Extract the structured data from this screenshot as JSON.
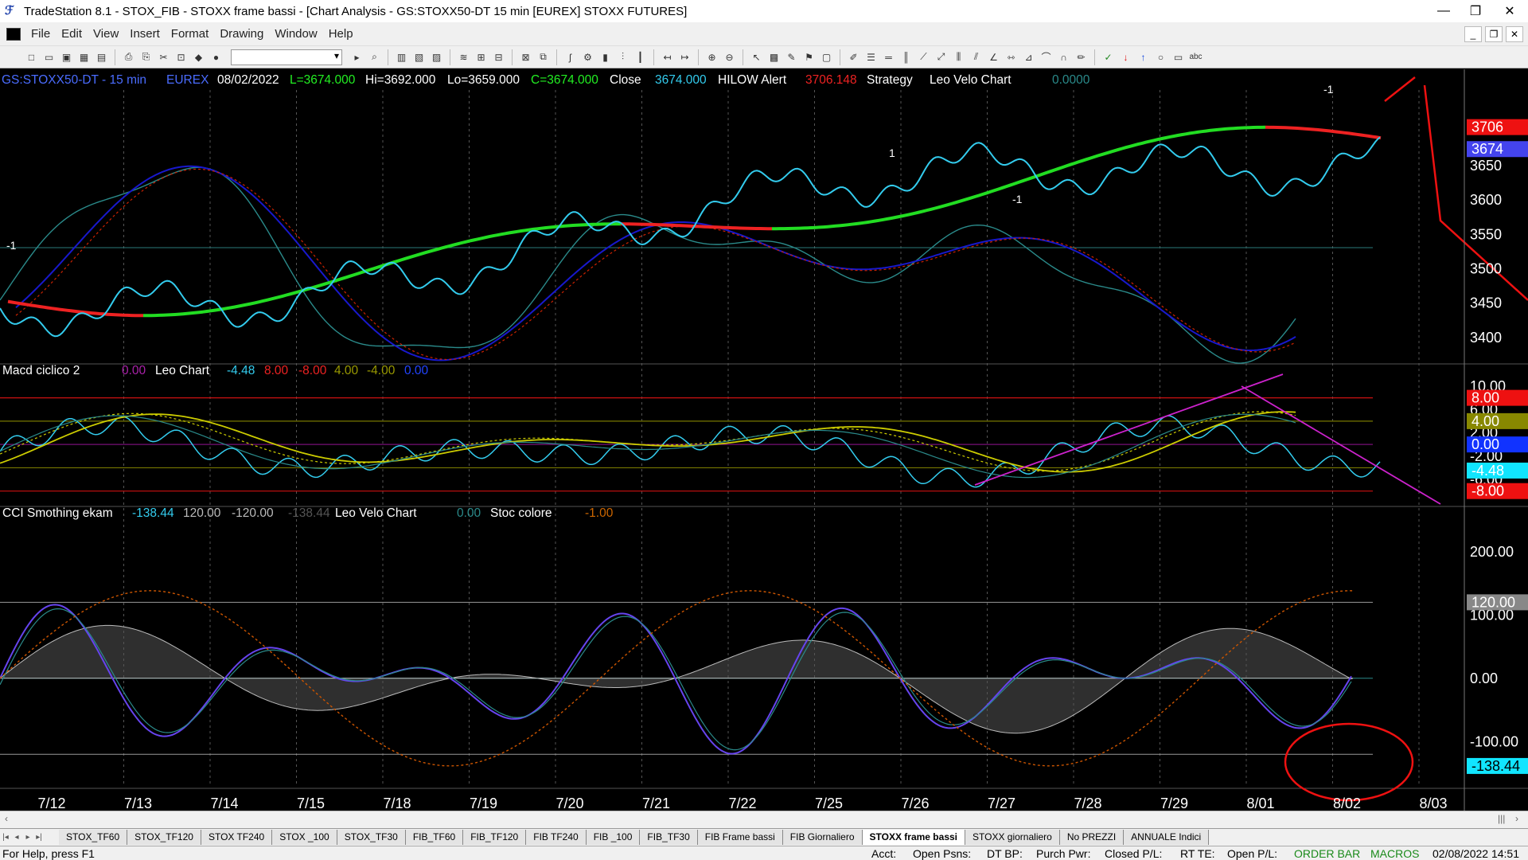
{
  "window": {
    "title": "TradeStation 8.1 - STOX_FIB - STOXX frame bassi - [Chart Analysis - GS:STOXX50-DT  15 min  [EUREX] STOXX FUTURES]",
    "minimize_icon": "minimize-icon",
    "restore_icon": "restore-icon",
    "close_icon": "close-icon"
  },
  "menu": {
    "items": [
      "File",
      "Edit",
      "View",
      "Insert",
      "Format",
      "Drawing",
      "Window",
      "Help"
    ]
  },
  "chart": {
    "price_pane": {
      "header": {
        "symbol": "GS:STOXX50-DT - 15 min",
        "exchange": "EUREX",
        "date": "08/02/2022",
        "last": "L=3674.000",
        "high": "Hi=3692.000",
        "low": "Lo=3659.000",
        "close_field": "C=3674.000",
        "close_label": "Close",
        "close_value": "3674.000",
        "hilow_label": "HILOW Alert",
        "hilow_value": "3706.148",
        "strategy_label": "Strategy",
        "leo_velo_label": "Leo Velo Chart",
        "leo_velo_value": "0.0000"
      },
      "ylim": [
        3365,
        3760
      ],
      "ticks": [
        "3650",
        "3600",
        "3550",
        "3500",
        "3450",
        "3400"
      ],
      "tick_values": [
        3650,
        3600,
        3550,
        3500,
        3450,
        3400
      ],
      "marker_red": "3706",
      "marker_red_value": 3706,
      "marker_blue": "3674",
      "marker_blue_value": 3674,
      "signal_labels": [
        "-1",
        "1",
        "-1",
        "1",
        "-1"
      ],
      "colors": {
        "price": "#33ccee",
        "ma_up": "#22dd22",
        "ma_down": "#ee2222",
        "osc_blue": "#1818cc",
        "osc_teal": "#2a8a8a",
        "osc_dotred": "#cc2200"
      }
    },
    "macd_pane": {
      "header": {
        "title": "Macd ciclico 2",
        "v1": "0.00",
        "leo_label": "Leo Chart",
        "v2": "-4.48",
        "v3": "8.00",
        "v4": "-8.00",
        "v5": "4.00",
        "v6": "-4.00",
        "v7": "0.00"
      },
      "ylim": [
        -10.5,
        11.5
      ],
      "ticks": [
        "10.00",
        "6.00",
        "2.00",
        "-2.00",
        "-6.00"
      ],
      "tick_values": [
        10,
        6,
        2,
        -2,
        -6
      ],
      "markers": [
        {
          "label": "8.00",
          "value": 8,
          "color": "#ee1111"
        },
        {
          "label": "4.00",
          "value": 4,
          "color": "#888800"
        },
        {
          "label": "0.00",
          "value": 0,
          "color": "#1133ff"
        },
        {
          "label": "-4.48",
          "value": -4.48,
          "color": "#11e5ff"
        },
        {
          "label": "-8.00",
          "value": -8,
          "color": "#ee1111"
        }
      ]
    },
    "cci_pane": {
      "header": {
        "title": "CCI Smothing ekam",
        "v1": "-138.44",
        "v2": "120.00",
        "v3": "-120.00",
        "v4": "-138.44",
        "leo_label": "Leo Velo Chart",
        "v5": "0.00",
        "stoc_label": "Stoc colore",
        "v6": "-1.00"
      },
      "ylim": [
        -170,
        250
      ],
      "ticks": [
        "200.00",
        "100.00",
        "0.00",
        "-100.00"
      ],
      "tick_values": [
        200,
        100,
        0,
        -100
      ],
      "markers": [
        {
          "label": "120.00",
          "value": 120,
          "color": "#aaaaaa"
        },
        {
          "label": "-138.44",
          "value": -138.44,
          "color": "#11e5ff"
        }
      ]
    },
    "dates": [
      "7/12",
      "7/13",
      "7/14",
      "7/15",
      "7/18",
      "7/19",
      "7/20",
      "7/21",
      "7/22",
      "7/25",
      "7/26",
      "7/27",
      "7/28",
      "7/29",
      "8/01",
      "8/02",
      "8/03"
    ]
  },
  "tabs": [
    "STOX_TF60",
    "STOX_TF120",
    "STOX TF240",
    "STOX _100",
    "STOX_TF30",
    "FIB_TF60",
    "FIB_TF120",
    "FIB TF240",
    "FIB _100",
    "FIB_TF30",
    "FIB Frame bassi",
    "FIB Giornaliero",
    "STOXX frame bassi",
    "STOXX giornaliero",
    "No PREZZI",
    "ANNUALE Indici"
  ],
  "active_tab": "STOXX frame bassi",
  "status": {
    "help": "For Help, press F1",
    "acct": "Acct:",
    "open_psns": "Open Psns:",
    "dt_bp": "DT BP:",
    "purch_pwr": "Purch Pwr:",
    "closed_pl": "Closed P/L:",
    "rt_te": "RT TE:",
    "open_pl": "Open P/L:",
    "order_bar": "ORDER BAR",
    "macros": "MACROS",
    "datetime": "02/08/2022 14:51"
  }
}
